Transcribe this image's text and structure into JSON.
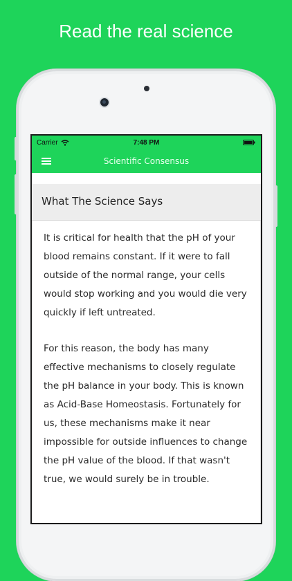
{
  "promo": {
    "headline": "Read the real science"
  },
  "status_bar": {
    "carrier": "Carrier",
    "time": "7:48 PM",
    "icons": [
      "wifi-icon",
      "battery-icon"
    ]
  },
  "nav": {
    "title": "Scientific Consensus",
    "menu_icon": "hamburger-menu-icon"
  },
  "card": {
    "title": "What The Science Says",
    "paragraphs": [
      "It is critical for health that the pH of your blood remains constant. If it were to fall outside of the normal range, your cells would stop working and you would die very quickly if left untreated.",
      "For this reason, the body has many effective mechanisms to closely regulate the pH balance in your body. This is known as Acid-Base Homeostasis. Fortunately for us, these mechanisms make it near impossible for outside influences to change the pH value of the blood. If that wasn't true, we would surely be in trouble."
    ]
  },
  "colors": {
    "brand_green": "#1ed45a",
    "card_header_bg": "#ededed"
  }
}
